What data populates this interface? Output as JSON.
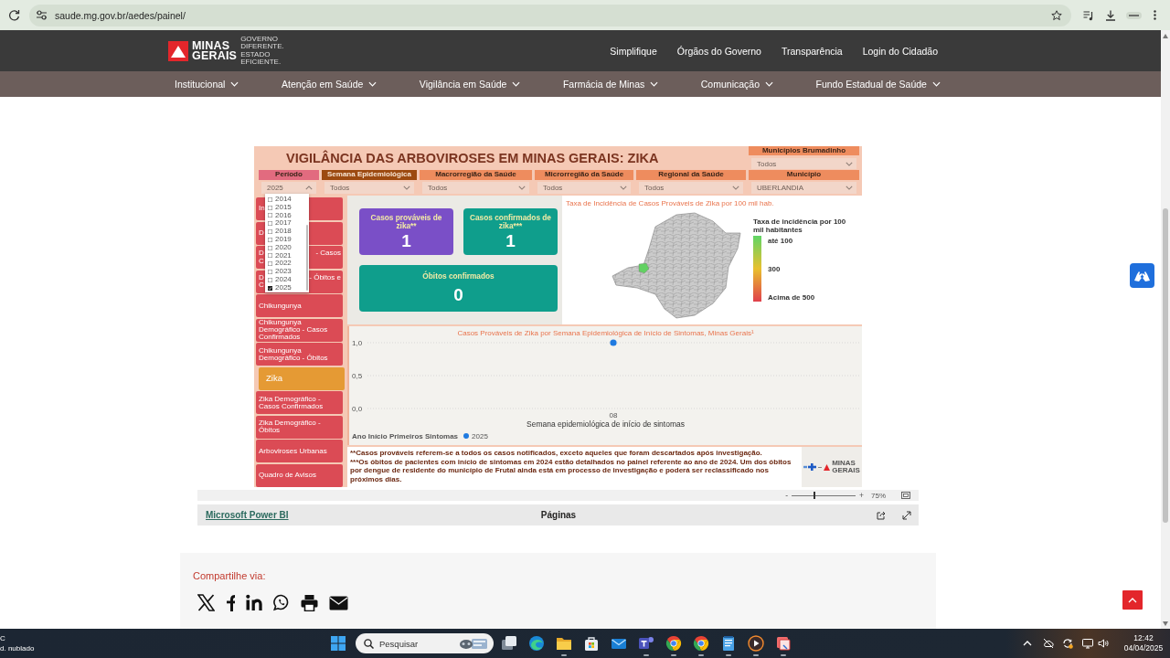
{
  "browser": {
    "url": "saude.mg.gov.br/aedes/painel/"
  },
  "site_header": {
    "logo_text": "MINAS GERAIS",
    "tagline": "GOVERNO DIFERENTE. ESTADO EFICIENTE.",
    "links": [
      "Simplifique",
      "Órgãos do Governo",
      "Transparência",
      "Login do Cidadão"
    ]
  },
  "main_menu": [
    "Institucional",
    "Atenção em Saúde",
    "Vigilância em Saúde",
    "Farmácia de Minas",
    "Comunicação",
    "Fundo Estadual de Saúde"
  ],
  "report": {
    "title": "VIGILÂNCIA DAS ARBOVIROSES EM MINAS GERAIS: ZIKA",
    "side_filter": {
      "label": "Municípios Brumadinho",
      "color": "#ee8c5e",
      "value": "Todos"
    },
    "filters": [
      {
        "label": "Período",
        "color": "#e26b7f",
        "value": "2025",
        "expanded": true,
        "options": [
          {
            "label": "2014",
            "checked": false
          },
          {
            "label": "2015",
            "checked": false
          },
          {
            "label": "2016",
            "checked": false
          },
          {
            "label": "2017",
            "checked": false
          },
          {
            "label": "2018",
            "checked": false
          },
          {
            "label": "2019",
            "checked": false
          },
          {
            "label": "2020",
            "checked": false
          },
          {
            "label": "2021",
            "checked": false
          },
          {
            "label": "2022",
            "checked": false
          },
          {
            "label": "2023",
            "checked": false
          },
          {
            "label": "2024",
            "checked": false
          },
          {
            "label": "2025",
            "checked": true
          }
        ]
      },
      {
        "label": "Semana Epidemiológica",
        "color": "#9c4a10",
        "value": "Todos",
        "expanded": false
      },
      {
        "label": "Macrorregião da Saúde",
        "color": "#ee8c5e",
        "value": "Todos",
        "expanded": false
      },
      {
        "label": "Microrregião da Saúde",
        "color": "#ee8c5e",
        "value": "Todos",
        "expanded": false
      },
      {
        "label": "Regional da Saúde",
        "color": "#ee8c5e",
        "value": "Todos",
        "expanded": false
      },
      {
        "label": "Município",
        "color": "#ee8c5e",
        "value": "UBERLANDIA",
        "expanded": false
      }
    ],
    "pages": [
      {
        "kind": "covered",
        "lines": [
          [
            "In"
          ]
        ],
        "selected": false
      },
      {
        "kind": "covered",
        "lines": [
          [
            "D"
          ]
        ],
        "selected": false
      },
      {
        "kind": "covered",
        "lines": [
          [
            "D",
            "- Casos"
          ],
          [
            "C"
          ]
        ],
        "selected": false
      },
      {
        "kind": "covered",
        "lines": [
          [
            "D",
            "- Óbitos e"
          ],
          [
            "C"
          ]
        ],
        "selected": false
      },
      {
        "kind": "page",
        "label": "Chikungunya",
        "selected": false
      },
      {
        "kind": "page",
        "label": "Chikungunya Demográfico - Casos Confirmados",
        "selected": false
      },
      {
        "kind": "page",
        "label": "Chikungunya Demográfico - Óbitos",
        "selected": false
      },
      {
        "kind": "page",
        "label": "Zika",
        "selected": true
      },
      {
        "kind": "page",
        "label": "Zika Demográfico - Casos Confirmados",
        "selected": false
      },
      {
        "kind": "page",
        "label": "Zika Demográfico - Óbitos",
        "selected": false
      },
      {
        "kind": "page",
        "label": "Arboviroses Urbanas",
        "selected": false
      },
      {
        "kind": "page",
        "label": "Quadro de Avisos",
        "selected": false
      }
    ],
    "kpis": [
      {
        "title": "Casos prováveis de zika**",
        "value": "1",
        "color": "#7a4fc7"
      },
      {
        "title": "Casos confirmados de zika***",
        "value": "1",
        "color": "#0f9e8c"
      },
      {
        "title": "Óbitos confirmados",
        "value": "0",
        "color": "#0f9e8c"
      }
    ],
    "map": {
      "title": "Taxa de Incidência de Casos Prováveis de Zika por 100 mil hab.",
      "legend_title": "Taxa de incidência por 100 mil habitantes",
      "legend_labels": [
        "até 100",
        "300",
        "Acima de 500"
      ]
    },
    "chart": {
      "chart_data": {
        "type": "line",
        "title": "Casos Prováveis de Zika por Semana Epidemiológica de Início de Sintomas, Minas Gerais¹",
        "xlabel": "Semana epidemiológica de início de sintomas",
        "categories": [
          "08"
        ],
        "series": [
          {
            "name": "2025",
            "color": "#1f7ae0",
            "marker": "circle",
            "values": [
              1
            ]
          }
        ],
        "ylim": [
          0,
          1
        ],
        "yticks": [
          {
            "value": 0,
            "label": "0,0"
          },
          {
            "value": 0.5,
            "label": "0,5"
          },
          {
            "value": 1,
            "label": "1,0"
          }
        ]
      },
      "legend_title": "Ano Início Primeiros Sintomas"
    },
    "footnotes": [
      "**Casos prováveis referem-se a todos os casos notificados, exceto aqueles que foram descartados após investigação.",
      "***Os óbitos de pacientes com início de sintomas em 2024 estão detalhados no painel referente ao ano de 2024. Um dos óbitos por dengue de residente do município de Frutal ainda está em processo de investigação e poderá ser reclassificado nos próximos dias."
    ],
    "footer_logo_text": "MINAS GERAIS"
  },
  "powerbi": {
    "zoom_out": "-",
    "zoom_in": "+",
    "zoom_text": "75%",
    "zoom_slider": {
      "level": 0.35
    },
    "link": "Microsoft Power BI",
    "pages_label": "Páginas"
  },
  "share": {
    "label": "Compartilhe via:"
  },
  "taskbar": {
    "weather": [
      "C",
      "d. nublado"
    ],
    "search": {
      "placeholder": "Pesquisar"
    },
    "apps": [
      {
        "kind": "stacked-windows",
        "running": false
      },
      {
        "kind": "swirl",
        "running": false
      },
      {
        "kind": "folder",
        "running": true
      },
      {
        "kind": "bag",
        "running": false
      },
      {
        "kind": "envelope",
        "running": false
      },
      {
        "kind": "tile",
        "running": true
      },
      {
        "kind": "circle-browser",
        "running": true
      },
      {
        "kind": "circle-browser",
        "running": true
      },
      {
        "kind": "notepad",
        "running": true
      },
      {
        "kind": "play",
        "running": true
      },
      {
        "kind": "crop",
        "running": true
      }
    ],
    "time": "12:42",
    "date": "04/04/2025"
  }
}
